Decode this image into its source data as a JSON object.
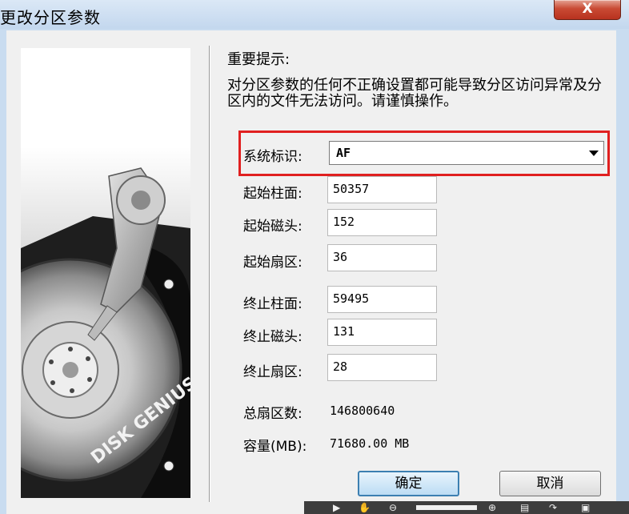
{
  "window": {
    "title": "更改分区参数",
    "close_label": "X"
  },
  "header": {
    "heading": "重要提示:",
    "notice": "对分区参数的任何不正确设置都可能导致分区访问异常及分区内的文件无法访问。请谨慎操作。"
  },
  "system_id": {
    "label": "系统标识:",
    "value": "AF"
  },
  "fields": {
    "start_cylinder": {
      "label": "起始柱面:",
      "value": "50357"
    },
    "start_head": {
      "label": "起始磁头:",
      "value": "152"
    },
    "start_sector": {
      "label": "起始扇区:",
      "value": "36"
    },
    "end_cylinder": {
      "label": "终止柱面:",
      "value": "59495"
    },
    "end_head": {
      "label": "终止磁头:",
      "value": "131"
    },
    "end_sector": {
      "label": "终止扇区:",
      "value": "28"
    }
  },
  "info": {
    "total_sectors_label": "总扇区数:",
    "total_sectors_value": "146800640",
    "capacity_label": "容量(MB):",
    "capacity_value": "71680.00 MB"
  },
  "buttons": {
    "ok": "确定",
    "cancel": "取消"
  },
  "art": {
    "brand_text": "DISK GENIUS"
  },
  "colors": {
    "highlight": "#e02020",
    "titlebar": "#c9dcf0",
    "close": "#c94a34",
    "ok_border": "#3c7fb1"
  },
  "icons": [
    "play-icon",
    "hand-icon",
    "zoom-out-icon",
    "zoom-in-icon",
    "page-icon",
    "page-arrow-icon",
    "fit-page-icon"
  ]
}
